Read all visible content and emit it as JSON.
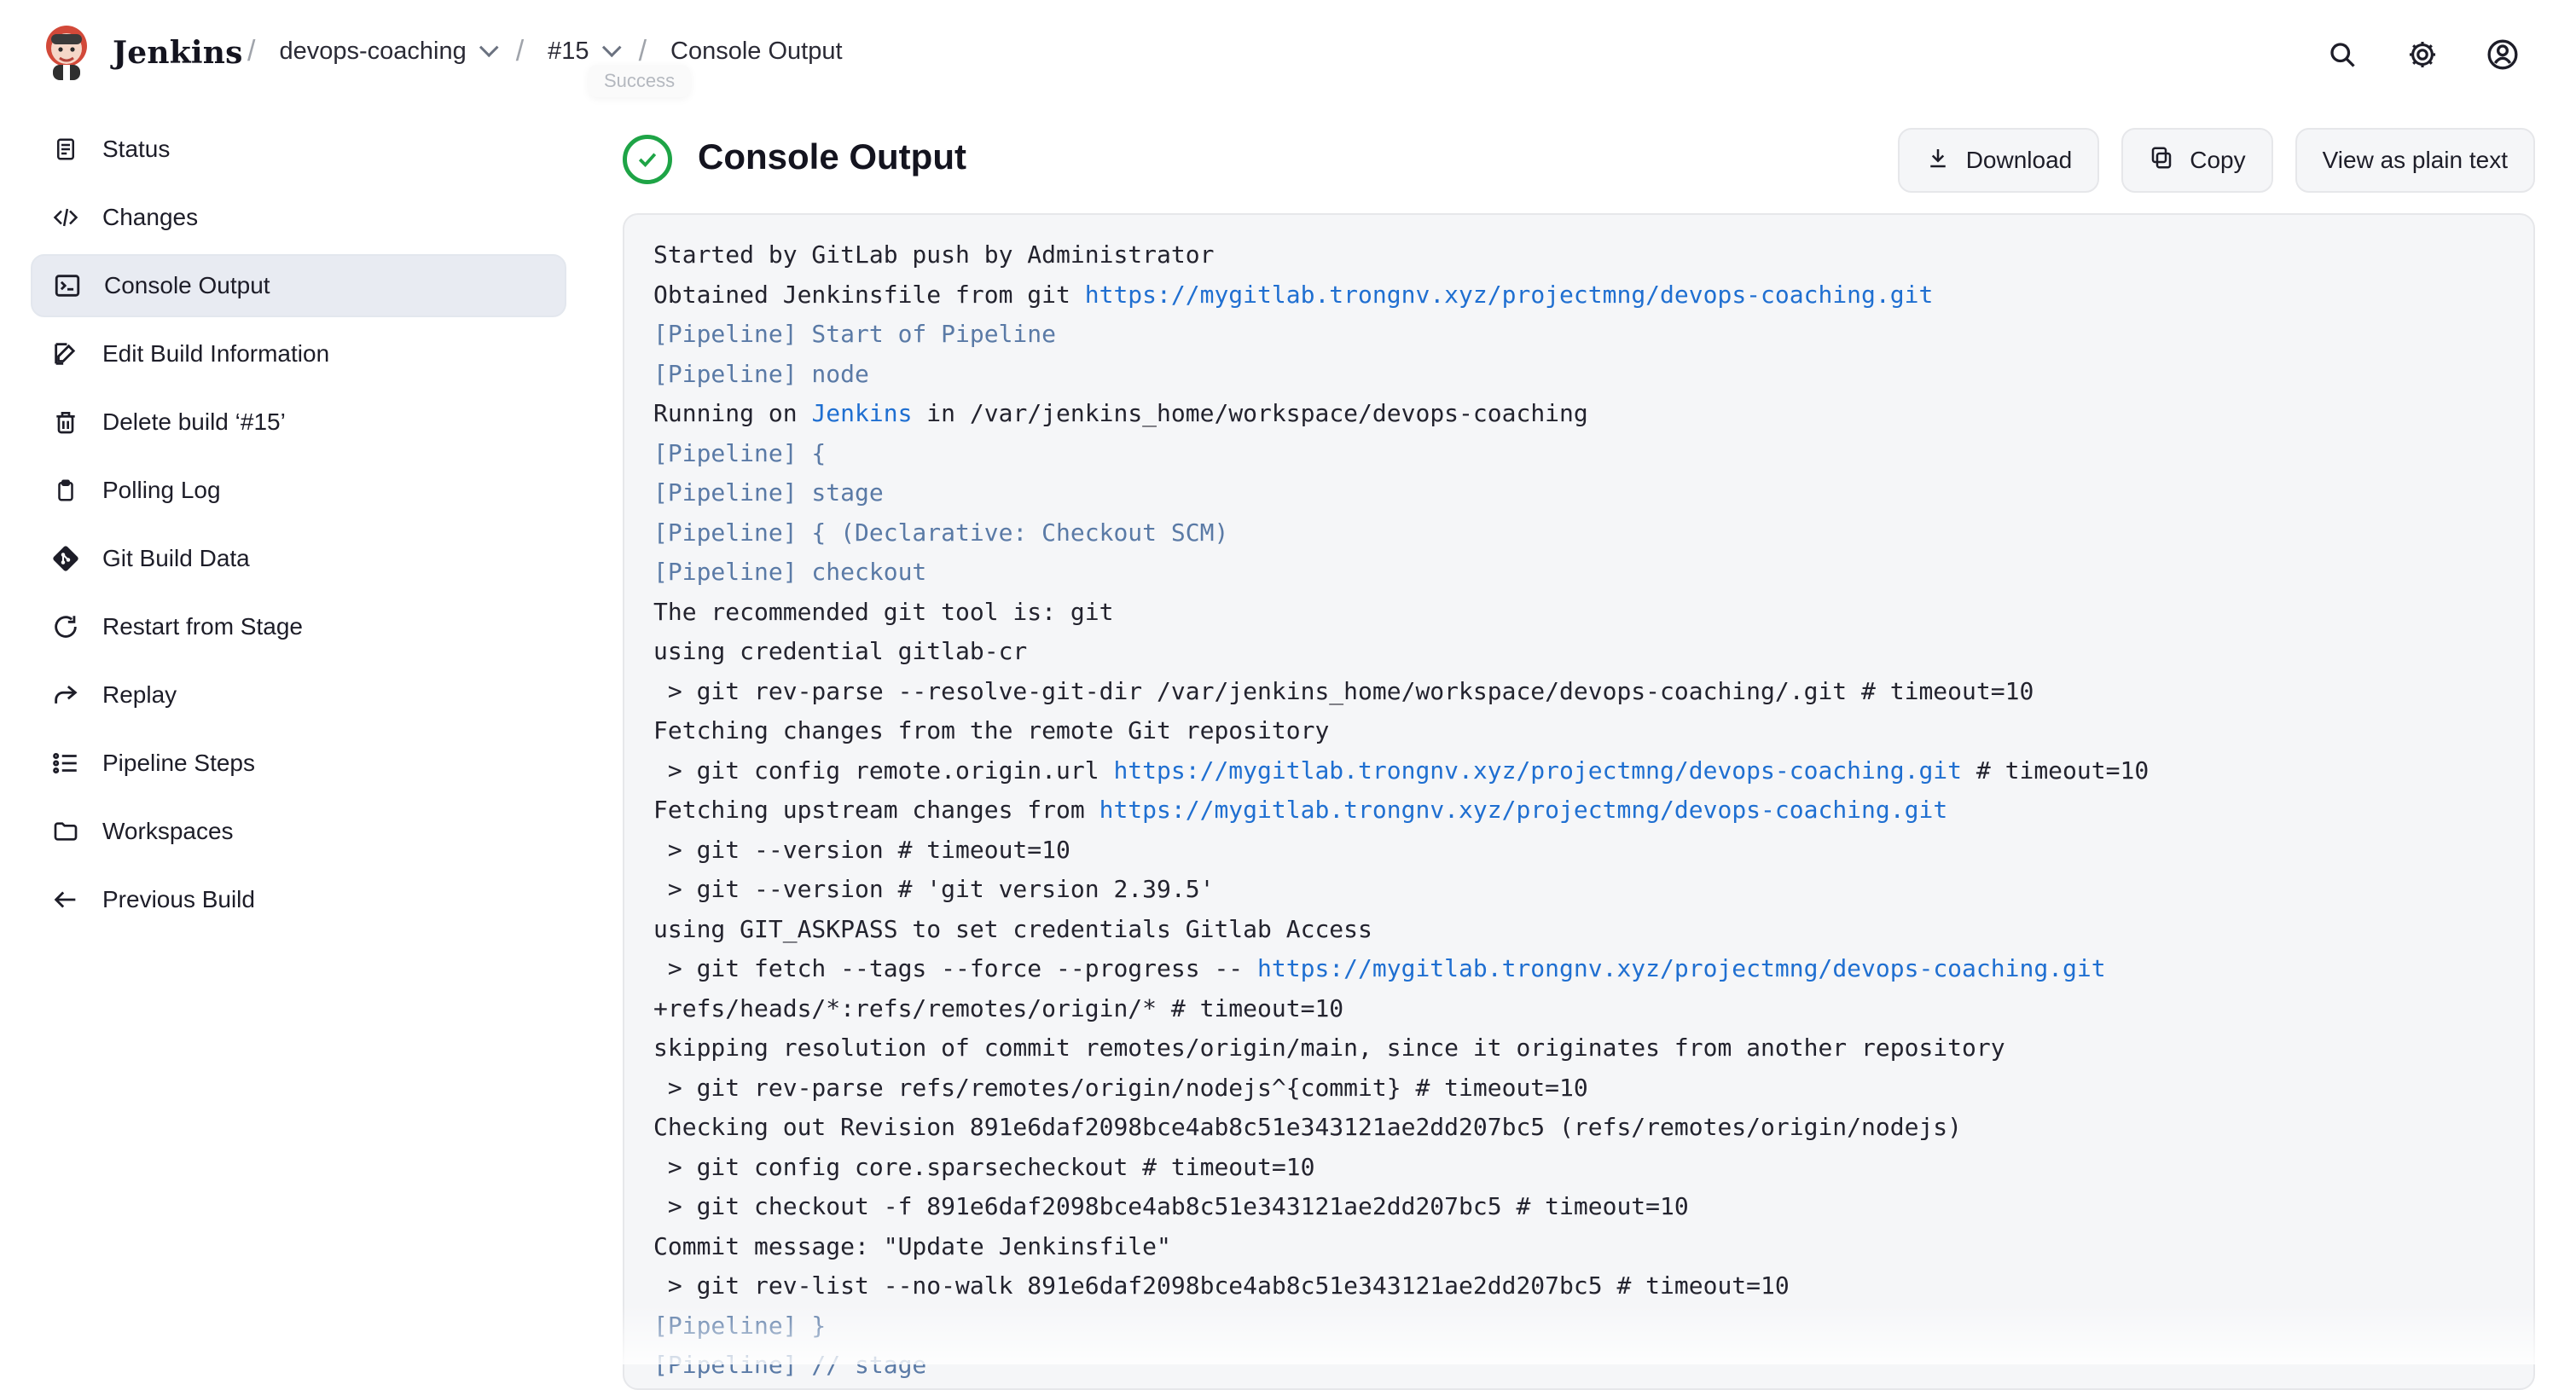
{
  "app": {
    "brand": "Jenkins"
  },
  "breadcrumb": {
    "project": "devops-coaching",
    "build": "#15",
    "page": "Console Output",
    "build_status_tooltip": "Success"
  },
  "header_icons": {
    "search": "search-icon",
    "settings": "gear-icon",
    "account": "user-icon"
  },
  "sidebar": {
    "items": [
      {
        "label": "Status",
        "icon": "document-icon",
        "active": false
      },
      {
        "label": "Changes",
        "icon": "code-icon",
        "active": false
      },
      {
        "label": "Console Output",
        "icon": "terminal-icon",
        "active": true
      },
      {
        "label": "Edit Build Information",
        "icon": "edit-icon",
        "active": false
      },
      {
        "label": "Delete build ‘#15’",
        "icon": "trash-icon",
        "active": false
      },
      {
        "label": "Polling Log",
        "icon": "clipboard-icon",
        "active": false
      },
      {
        "label": "Git Build Data",
        "icon": "git-icon",
        "active": false
      },
      {
        "label": "Restart from Stage",
        "icon": "restart-icon",
        "active": false
      },
      {
        "label": "Replay",
        "icon": "replay-icon",
        "active": false
      },
      {
        "label": "Pipeline Steps",
        "icon": "list-icon",
        "active": false
      },
      {
        "label": "Workspaces",
        "icon": "folder-icon",
        "active": false
      },
      {
        "label": "Previous Build",
        "icon": "arrow-left-icon",
        "active": false
      }
    ]
  },
  "main": {
    "title": "Console Output",
    "status_icon": "success-check-icon",
    "actions": {
      "download": "Download",
      "copy": "Copy",
      "plain": "View as plain text"
    }
  },
  "console": {
    "lines": [
      [
        {
          "text": "Started by GitLab push by Administrator"
        }
      ],
      [
        {
          "text": "Obtained Jenkinsfile from git "
        },
        {
          "text": "https://mygitlab.trongnv.xyz/projectmng/devops-coaching.git",
          "link": true
        }
      ],
      [
        {
          "text": "[Pipeline] Start of Pipeline",
          "pipeline": true
        }
      ],
      [
        {
          "text": "[Pipeline] node",
          "pipeline": true
        }
      ],
      [
        {
          "text": "Running on "
        },
        {
          "text": "Jenkins",
          "link": true
        },
        {
          "text": " in /var/jenkins_home/workspace/devops-coaching"
        }
      ],
      [
        {
          "text": "[Pipeline] {",
          "pipeline": true
        }
      ],
      [
        {
          "text": "[Pipeline] stage",
          "pipeline": true
        }
      ],
      [
        {
          "text": "[Pipeline] { (Declarative: Checkout SCM)",
          "pipeline": true
        }
      ],
      [
        {
          "text": "[Pipeline] checkout",
          "pipeline": true
        }
      ],
      [
        {
          "text": "The recommended git tool is: git"
        }
      ],
      [
        {
          "text": "using credential gitlab-cr"
        }
      ],
      [
        {
          "text": " > git rev-parse --resolve-git-dir /var/jenkins_home/workspace/devops-coaching/.git # timeout=10"
        }
      ],
      [
        {
          "text": "Fetching changes from the remote Git repository"
        }
      ],
      [
        {
          "text": " > git config remote.origin.url "
        },
        {
          "text": "https://mygitlab.trongnv.xyz/projectmng/devops-coaching.git",
          "link": true
        },
        {
          "text": " # timeout=10"
        }
      ],
      [
        {
          "text": "Fetching upstream changes from "
        },
        {
          "text": "https://mygitlab.trongnv.xyz/projectmng/devops-coaching.git",
          "link": true
        }
      ],
      [
        {
          "text": " > git --version # timeout=10"
        }
      ],
      [
        {
          "text": " > git --version # 'git version 2.39.5'"
        }
      ],
      [
        {
          "text": "using GIT_ASKPASS to set credentials Gitlab Access"
        }
      ],
      [
        {
          "text": " > git fetch --tags --force --progress -- "
        },
        {
          "text": "https://mygitlab.trongnv.xyz/projectmng/devops-coaching.git",
          "link": true
        }
      ],
      [
        {
          "text": "+refs/heads/*:refs/remotes/origin/* # timeout=10"
        }
      ],
      [
        {
          "text": "skipping resolution of commit remotes/origin/main, since it originates from another repository"
        }
      ],
      [
        {
          "text": " > git rev-parse refs/remotes/origin/nodejs^{commit} # timeout=10"
        }
      ],
      [
        {
          "text": "Checking out Revision 891e6daf2098bce4ab8c51e343121ae2dd207bc5 (refs/remotes/origin/nodejs)"
        }
      ],
      [
        {
          "text": " > git config core.sparsecheckout # timeout=10"
        }
      ],
      [
        {
          "text": " > git checkout -f 891e6daf2098bce4ab8c51e343121ae2dd207bc5 # timeout=10"
        }
      ],
      [
        {
          "text": "Commit message: \"Update Jenkinsfile\""
        }
      ],
      [
        {
          "text": " > git rev-list --no-walk 891e6daf2098bce4ab8c51e343121ae2dd207bc5 # timeout=10"
        }
      ],
      [
        {
          "text": "[Pipeline] }",
          "pipeline": true
        }
      ],
      [
        {
          "text": "[Pipeline] // stage",
          "pipeline": true
        }
      ]
    ]
  }
}
